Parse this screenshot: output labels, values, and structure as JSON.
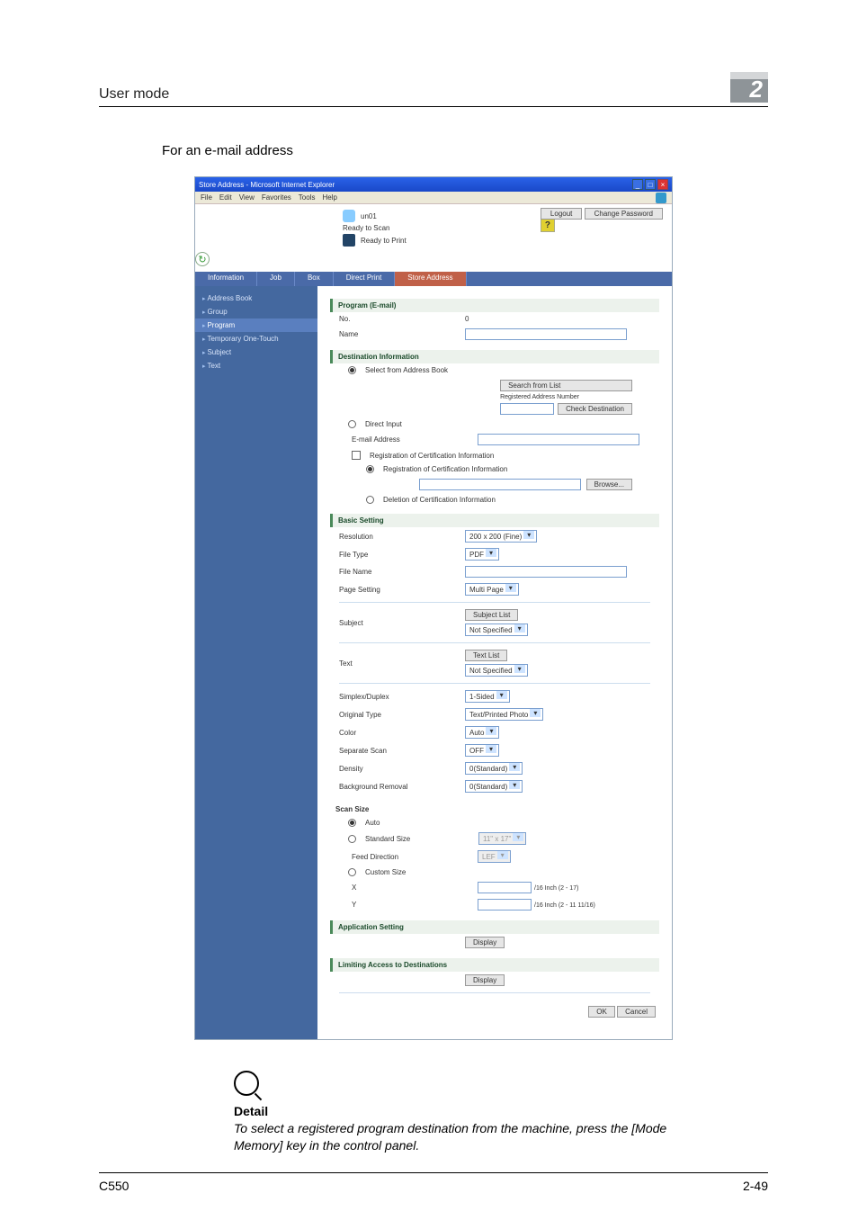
{
  "doc": {
    "running_head": "User mode",
    "chapter": "2",
    "section_title": "For an e-mail address",
    "model": "C550",
    "page_ref": "2-49"
  },
  "browser": {
    "title": "Store Address - Microsoft Internet Explorer",
    "menus": [
      "File",
      "Edit",
      "View",
      "Favorites",
      "Tools",
      "Help"
    ],
    "user": "un01",
    "status_scan": "Ready to Scan",
    "status_print": "Ready to Print",
    "btn_logout": "Logout",
    "btn_change_pw": "Change Password",
    "help_badge": "?",
    "refresh_icon": "↻"
  },
  "tabs": [
    "Information",
    "Job",
    "Box",
    "Direct Print",
    "Store Address"
  ],
  "active_tab": "Store Address",
  "sidebar": [
    "Address Book",
    "Group",
    "Program",
    "Temporary One-Touch",
    "Subject",
    "Text"
  ],
  "sidebar_active": "Program",
  "program": {
    "head": "Program (E-mail)",
    "no_label": "No.",
    "no_value": "0",
    "name_label": "Name"
  },
  "dest": {
    "head": "Destination Information",
    "opt_select": "Select from Address Book",
    "btn_search": "Search from List",
    "reg_num_label": "Registered Address Number",
    "btn_check": "Check Destination",
    "opt_direct": "Direct Input",
    "email_label": "E-mail Address",
    "chk_reg_cert": "Registration of Certification Information",
    "rad_reg_cert": "Registration of Certification Information",
    "btn_browse": "Browse...",
    "rad_del_cert": "Deletion of Certification Information"
  },
  "basic": {
    "head": "Basic Setting",
    "resolution_l": "Resolution",
    "resolution_v": "200 x 200 (Fine)",
    "filetype_l": "File Type",
    "filetype_v": "PDF",
    "filename_l": "File Name",
    "pageset_l": "Page Setting",
    "pageset_v": "Multi Page",
    "subject_l": "Subject",
    "subject_btn": "Subject List",
    "subject_v": "Not Specified",
    "text_l": "Text",
    "text_btn": "Text List",
    "text_v": "Not Specified",
    "simplex_l": "Simplex/Duplex",
    "simplex_v": "1-Sided",
    "origtype_l": "Original Type",
    "origtype_v": "Text/Printed Photo",
    "color_l": "Color",
    "color_v": "Auto",
    "sepscan_l": "Separate Scan",
    "sepscan_v": "OFF",
    "density_l": "Density",
    "density_v": "0(Standard)",
    "bg_l": "Background Removal",
    "bg_v": "0(Standard)"
  },
  "scan": {
    "head": "Scan Size",
    "opt_auto": "Auto",
    "opt_std": "Standard Size",
    "std_val": "11\" x 17\"",
    "feed_l": "Feed Direction",
    "feed_v": "LEF",
    "opt_custom": "Custom Size",
    "x_l": "X",
    "x_unit": "/16 Inch (2 - 17)",
    "y_l": "Y",
    "y_unit": "/16 Inch (2 - 11 11/16)"
  },
  "app": {
    "head": "Application Setting",
    "btn": "Display"
  },
  "limit": {
    "head": "Limiting Access to Destinations",
    "btn": "Display"
  },
  "footer": {
    "ok": "OK",
    "cancel": "Cancel"
  },
  "detail": {
    "head": "Detail",
    "body": "To select a registered program destination from the machine, press the [Mode Memory] key in the control panel."
  }
}
